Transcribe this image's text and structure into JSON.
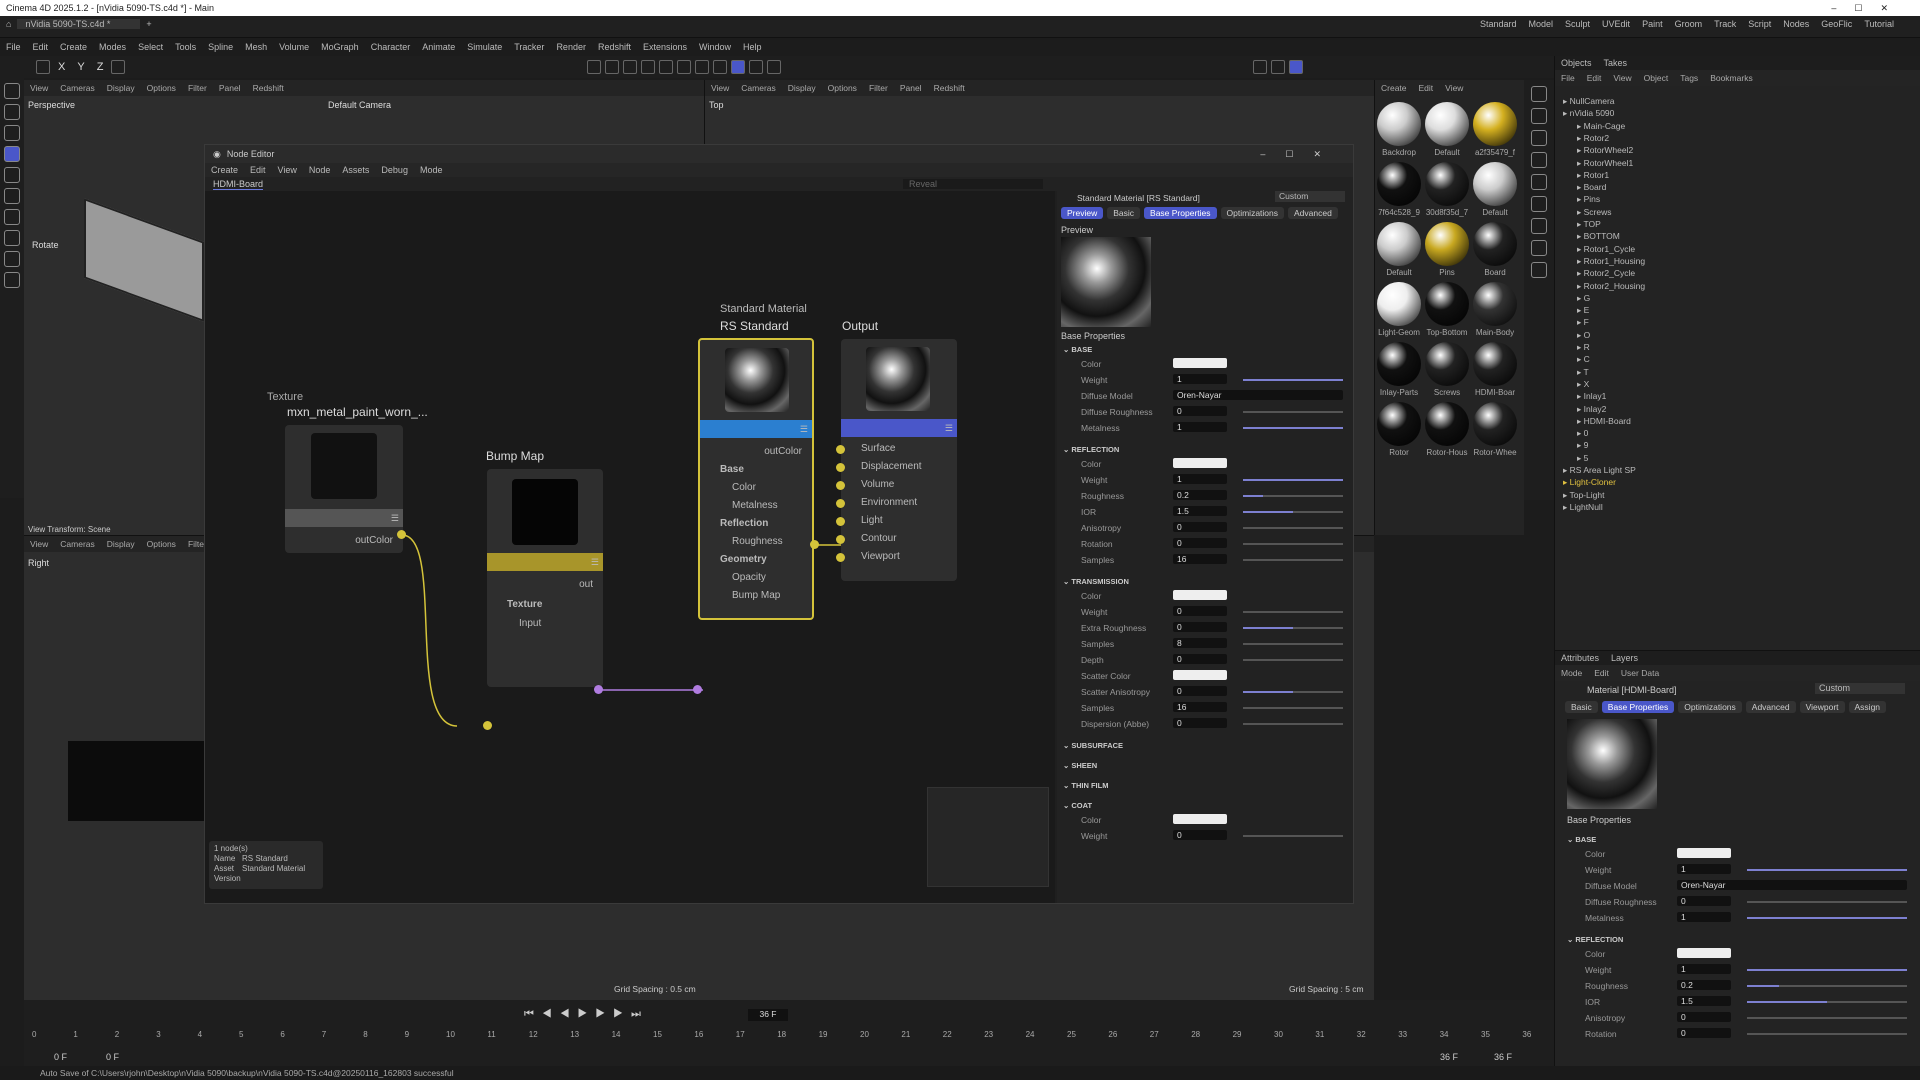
{
  "window_title": "Cinema 4D 2025.1.2 - [nVidia 5090-TS.c4d *] - Main",
  "tab": "nVidia 5090-TS.c4d *",
  "layouts": [
    "Standard",
    "Model",
    "Sculpt",
    "UVEdit",
    "Paint",
    "Groom",
    "Track",
    "Script",
    "Nodes",
    "GeoFlic",
    "Tutorial"
  ],
  "menu": [
    "File",
    "Edit",
    "Create",
    "Modes",
    "Select",
    "Tools",
    "Spline",
    "Mesh",
    "Volume",
    "MoGraph",
    "Character",
    "Animate",
    "Simulate",
    "Tracker",
    "Render",
    "Redshift",
    "Extensions",
    "Window",
    "Help"
  ],
  "toolbar": {
    "x": "X",
    "y": "Y",
    "z": "Z"
  },
  "viewport": {
    "menu": [
      "View",
      "Cameras",
      "Display",
      "Options",
      "Filter",
      "Panel",
      "Redshift"
    ],
    "name": "Perspective",
    "camera": "Default Camera",
    "rotate": "Rotate",
    "transform": "View Transform: Scene"
  },
  "viewport_top": {
    "menu": [
      "View",
      "Cameras",
      "Display",
      "Options",
      "Filter",
      "Panel",
      "Redshift"
    ],
    "name": "Top"
  },
  "viewport_right": {
    "menu": [
      "View",
      "Cameras",
      "Display",
      "Options",
      "Filter"
    ],
    "name": "Right"
  },
  "node_editor": {
    "title": "Node Editor",
    "menu": [
      "Create",
      "Edit",
      "View",
      "Node",
      "Assets",
      "Debug",
      "Mode"
    ],
    "breadcrumb": "HDMI-Board",
    "reveal": "Reveal",
    "texture": {
      "caption": "Texture",
      "title": "mxn_metal_paint_worn_...",
      "out": "outColor"
    },
    "bump": {
      "title": "Bump Map",
      "out": "out",
      "group": "Texture",
      "in": "Input"
    },
    "std": {
      "caption": "Standard Material",
      "title": "RS Standard",
      "out": "outColor",
      "g1": "Base",
      "p1": "Color",
      "p2": "Metalness",
      "g2": "Reflection",
      "p3": "Roughness",
      "g3": "Geometry",
      "p4": "Opacity",
      "p5": "Bump Map"
    },
    "output": {
      "title": "Output",
      "ports": [
        "Surface",
        "Displacement",
        "Volume",
        "Environment",
        "Light",
        "Contour",
        "Viewport"
      ]
    },
    "info": {
      "count": "1 node(s)",
      "name_l": "Name",
      "name_v": "RS Standard",
      "asset_l": "Asset",
      "asset_v": "Standard Material",
      "version_l": "Version"
    }
  },
  "attr_ne": {
    "header": "Standard Material [RS Standard]",
    "custom": "Custom",
    "tabs": [
      "Preview",
      "Basic",
      "Base Properties",
      "Optimizations",
      "Advanced"
    ],
    "preview": "Preview",
    "base_properties": "Base Properties",
    "base": "BASE",
    "reflection": "REFLECTION",
    "transmission": "TRANSMISSION",
    "subsurface": "SUBSURFACE",
    "sheen": "SHEEN",
    "thin_film": "THIN FILM",
    "coat": "COAT",
    "base_rows": [
      {
        "l": "Color",
        "v": ""
      },
      {
        "l": "Weight",
        "v": "1",
        "f": 1
      },
      {
        "l": "Diffuse Model",
        "v": "Oren-Nayar"
      },
      {
        "l": "Diffuse Roughness",
        "v": "0",
        "f": 0
      },
      {
        "l": "Metalness",
        "v": "1",
        "f": 1
      }
    ],
    "refl_rows": [
      {
        "l": "Color",
        "v": ""
      },
      {
        "l": "Weight",
        "v": "1",
        "f": 1
      },
      {
        "l": "Roughness",
        "v": "0.2",
        "f": 0.2
      },
      {
        "l": "IOR",
        "v": "1.5",
        "f": 0.5
      },
      {
        "l": "Anisotropy",
        "v": "0",
        "f": 0
      },
      {
        "l": "Rotation",
        "v": "0",
        "f": 0
      },
      {
        "l": "Samples",
        "v": "16",
        "f": 0
      }
    ],
    "trans_rows": [
      {
        "l": "Color",
        "v": ""
      },
      {
        "l": "Weight",
        "v": "0",
        "f": 0
      },
      {
        "l": "Extra Roughness",
        "v": "0",
        "f": 0.5
      },
      {
        "l": "Samples",
        "v": "8",
        "f": 0
      },
      {
        "l": "Depth",
        "v": "0",
        "f": 0
      },
      {
        "l": "Scatter Color",
        "v": ""
      },
      {
        "l": "Scatter Anisotropy",
        "v": "0",
        "f": 0.5
      },
      {
        "l": "Samples",
        "v": "16",
        "f": 0
      },
      {
        "l": "Dispersion (Abbe)",
        "v": "0",
        "f": 0
      }
    ],
    "coat_rows": [
      {
        "l": "Color",
        "v": ""
      },
      {
        "l": "Weight",
        "v": "0",
        "f": 0
      }
    ]
  },
  "materials": {
    "menu": [
      "Create",
      "Edit",
      "View"
    ],
    "items": [
      "Backdrop",
      "Default",
      "a2f35479_f",
      "7f64c528_9",
      "30d8f35d_7",
      "Default",
      "Default",
      "Pins",
      "Board",
      "Light-Geom",
      "Top-Bottom",
      "Main-Body",
      "Inlay-Parts",
      "Screws",
      "HDMI-Boar",
      "Rotor",
      "Rotor-Hous",
      "Rotor-Whee"
    ]
  },
  "objects": {
    "tabs": [
      "Objects",
      "Takes"
    ],
    "menu": [
      "File",
      "Edit",
      "View",
      "Object",
      "Tags",
      "Bookmarks"
    ],
    "items": [
      "NullCamera",
      "nVidia 5090",
      "Main-Cage",
      "Rotor2",
      "RotorWheel2",
      "RotorWheel1",
      "Rotor1",
      "Board",
      "Pins",
      "Screws",
      "TOP",
      "BOTTOM",
      "Rotor1_Cycle",
      "Rotor1_Housing",
      "Rotor2_Cycle",
      "Rotor2_Housing",
      "G",
      "E",
      "F",
      "O",
      "R",
      "C",
      "T",
      "X",
      "Inlay1",
      "Inlay2",
      "HDMI-Board",
      "0",
      "9",
      "5",
      "RS Area Light SP",
      "Light-Cloner",
      "Top-Light",
      "LightNull"
    ]
  },
  "attributes": {
    "tabs": [
      "Attributes",
      "Layers"
    ],
    "menu": [
      "Mode",
      "Edit",
      "User Data"
    ],
    "header": "Material [HDMI-Board]",
    "custom": "Custom",
    "subtabs": [
      "Basic",
      "Base Properties",
      "Optimizations",
      "Advanced",
      "Viewport",
      "Assign"
    ],
    "base_properties": "Base Properties",
    "base": "BASE",
    "reflection": "REFLECTION",
    "base_rows": [
      {
        "l": "Color",
        "v": ""
      },
      {
        "l": "Weight",
        "v": "1",
        "f": 1
      },
      {
        "l": "Diffuse Model",
        "v": "Oren-Nayar"
      },
      {
        "l": "Diffuse Roughness",
        "v": "0",
        "f": 0
      },
      {
        "l": "Metalness",
        "v": "1",
        "f": 1
      }
    ],
    "refl_rows": [
      {
        "l": "Color",
        "v": ""
      },
      {
        "l": "Weight",
        "v": "1",
        "f": 1
      },
      {
        "l": "Roughness",
        "v": "0.2",
        "f": 0.2
      },
      {
        "l": "IOR",
        "v": "1.5",
        "f": 0.5
      },
      {
        "l": "Anisotropy",
        "v": "0",
        "f": 0
      },
      {
        "l": "Rotation",
        "v": "0",
        "f": 0
      }
    ]
  },
  "grid_left": "Grid Spacing : 0.5 cm",
  "grid_right": "Grid Spacing : 5 cm",
  "timeline": {
    "frame": "36 F",
    "start": "0 F",
    "start2": "0 F",
    "end": "36 F",
    "end2": "36 F",
    "ticks": [
      "0",
      "1",
      "2",
      "3",
      "4",
      "5",
      "6",
      "7",
      "8",
      "9",
      "10",
      "11",
      "12",
      "13",
      "14",
      "15",
      "16",
      "17",
      "18",
      "19",
      "20",
      "21",
      "22",
      "23",
      "24",
      "25",
      "26",
      "27",
      "28",
      "29",
      "30",
      "31",
      "32",
      "33",
      "34",
      "35",
      "36"
    ]
  },
  "status": "Auto Save of C:\\Users\\rjohn\\Desktop\\nVidia 5090\\backup\\nVidia 5090-TS.c4d@20250116_162803 successful"
}
